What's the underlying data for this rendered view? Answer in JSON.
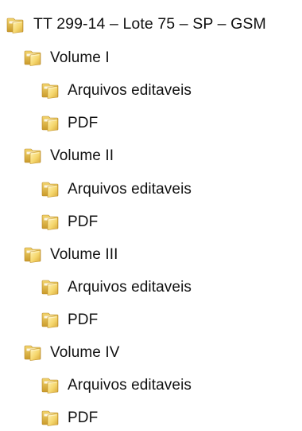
{
  "tree": {
    "root": {
      "label": "TT 299-14 – Lote 75 – SP – GSM",
      "icon": "folder-icon"
    },
    "volumes": [
      {
        "label": "Volume I",
        "icon": "folder-icon",
        "children": [
          {
            "label": "Arquivos editaveis",
            "icon": "folder-icon"
          },
          {
            "label": "PDF",
            "icon": "folder-icon"
          }
        ]
      },
      {
        "label": "Volume II",
        "icon": "folder-icon",
        "children": [
          {
            "label": "Arquivos editaveis",
            "icon": "folder-icon"
          },
          {
            "label": "PDF",
            "icon": "folder-icon"
          }
        ]
      },
      {
        "label": "Volume III",
        "icon": "folder-icon",
        "children": [
          {
            "label": "Arquivos editaveis",
            "icon": "folder-icon"
          },
          {
            "label": "PDF",
            "icon": "folder-icon"
          }
        ]
      },
      {
        "label": "Volume IV",
        "icon": "folder-icon",
        "children": [
          {
            "label": "Arquivos editaveis",
            "icon": "folder-icon"
          },
          {
            "label": "PDF",
            "icon": "folder-icon"
          }
        ]
      }
    ]
  }
}
